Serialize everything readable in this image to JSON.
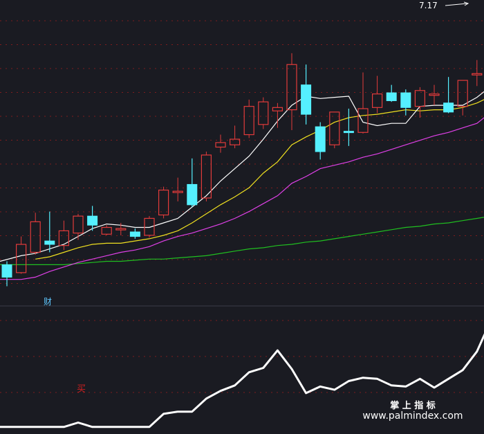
{
  "chart_data": [
    {
      "type": "candlestick",
      "panel": "price",
      "ylim": [
        4.55,
        7.2
      ],
      "colors": {
        "up": "#e33b3b",
        "down": "#55f0ff",
        "ma5": "#ffffff",
        "ma10": "#f0e020",
        "ma20": "#e040e8",
        "ma60": "#20c020",
        "grid": "#8a1e1e"
      },
      "annotations": {
        "high_label": "7.17",
        "finance_marker": "财"
      },
      "candles": [
        {
          "x": 0,
          "open": 4.89,
          "close": 4.78,
          "high": 4.92,
          "low": 4.7
        },
        {
          "x": 1,
          "open": 4.82,
          "close": 5.07,
          "high": 5.14,
          "low": 4.81
        },
        {
          "x": 2,
          "open": 5.0,
          "close": 5.27,
          "high": 5.35,
          "low": 4.98
        },
        {
          "x": 3,
          "open": 5.1,
          "close": 5.07,
          "high": 5.36,
          "low": 5.0
        },
        {
          "x": 4,
          "open": 5.06,
          "close": 5.19,
          "high": 5.28,
          "low": 5.02
        },
        {
          "x": 5,
          "open": 5.17,
          "close": 5.32,
          "high": 5.34,
          "low": 5.11
        },
        {
          "x": 6,
          "open": 5.32,
          "close": 5.24,
          "high": 5.41,
          "low": 5.19
        },
        {
          "x": 7,
          "open": 5.16,
          "close": 5.22,
          "high": 5.24,
          "low": 5.15
        },
        {
          "x": 8,
          "open": 5.2,
          "close": 5.21,
          "high": 5.26,
          "low": 5.15
        },
        {
          "x": 9,
          "open": 5.18,
          "close": 5.14,
          "high": 5.21,
          "low": 5.12
        },
        {
          "x": 10,
          "open": 5.15,
          "close": 5.3,
          "high": 5.32,
          "low": 5.13
        },
        {
          "x": 11,
          "open": 5.33,
          "close": 5.55,
          "high": 5.58,
          "low": 5.3
        },
        {
          "x": 12,
          "open": 5.53,
          "close": 5.54,
          "high": 5.66,
          "low": 5.45
        },
        {
          "x": 13,
          "open": 5.6,
          "close": 5.42,
          "high": 5.83,
          "low": 5.4
        },
        {
          "x": 14,
          "open": 5.48,
          "close": 5.86,
          "high": 5.89,
          "low": 5.45
        },
        {
          "x": 15,
          "open": 5.93,
          "close": 5.97,
          "high": 6.04,
          "low": 5.88
        },
        {
          "x": 16,
          "open": 5.95,
          "close": 6.0,
          "high": 6.12,
          "low": 5.92
        },
        {
          "x": 17,
          "open": 6.04,
          "close": 6.29,
          "high": 6.35,
          "low": 6.01
        },
        {
          "x": 18,
          "open": 6.13,
          "close": 6.33,
          "high": 6.37,
          "low": 6.09
        },
        {
          "x": 19,
          "open": 6.25,
          "close": 6.28,
          "high": 6.32,
          "low": 6.1
        },
        {
          "x": 20,
          "open": 6.26,
          "close": 6.66,
          "high": 6.76,
          "low": 6.08
        },
        {
          "x": 21,
          "open": 6.48,
          "close": 6.22,
          "high": 6.66,
          "low": 6.13
        },
        {
          "x": 22,
          "open": 6.11,
          "close": 5.89,
          "high": 6.15,
          "low": 5.82
        },
        {
          "x": 23,
          "open": 5.95,
          "close": 6.24,
          "high": 6.24,
          "low": 5.92
        },
        {
          "x": 24,
          "open": 6.07,
          "close": 6.06,
          "high": 6.27,
          "low": 5.94
        },
        {
          "x": 25,
          "open": 6.06,
          "close": 6.27,
          "high": 6.59,
          "low": 6.05
        },
        {
          "x": 26,
          "open": 6.28,
          "close": 6.4,
          "high": 6.56,
          "low": 6.23
        },
        {
          "x": 27,
          "open": 6.41,
          "close": 6.34,
          "high": 6.48,
          "low": 6.33
        },
        {
          "x": 28,
          "open": 6.41,
          "close": 6.28,
          "high": 6.44,
          "low": 6.21
        },
        {
          "x": 29,
          "open": 6.29,
          "close": 6.43,
          "high": 6.46,
          "low": 6.19
        },
        {
          "x": 30,
          "open": 6.4,
          "close": 6.4,
          "high": 6.48,
          "low": 6.3
        },
        {
          "x": 31,
          "open": 6.32,
          "close": 6.24,
          "high": 6.55,
          "low": 6.23
        },
        {
          "x": 32,
          "open": 6.29,
          "close": 6.52,
          "high": 6.52,
          "low": 6.21
        },
        {
          "x": 33,
          "open": 6.57,
          "close": 6.58,
          "high": 6.7,
          "low": 6.47
        },
        {
          "x": 34,
          "open": 6.58,
          "close": 7.03,
          "high": 7.17,
          "low": 6.55
        }
      ],
      "moving_averages": {
        "ma5": [
          4.92,
          4.97,
          4.99,
          5.03,
          5.07,
          5.14,
          5.21,
          5.25,
          5.24,
          5.22,
          5.22,
          5.26,
          5.3,
          5.4,
          5.5,
          5.63,
          5.74,
          5.85,
          6.0,
          6.16,
          6.3,
          6.38,
          6.36,
          6.37,
          6.38,
          6.15,
          6.12,
          6.14,
          6.14,
          6.29,
          6.3,
          6.3,
          6.3,
          6.37,
          6.47
        ],
        "ma10": [
          null,
          null,
          4.94,
          4.96,
          5.0,
          5.04,
          5.07,
          5.08,
          5.08,
          5.1,
          5.12,
          5.15,
          5.19,
          5.26,
          5.34,
          5.42,
          5.49,
          5.57,
          5.7,
          5.8,
          5.95,
          6.02,
          6.08,
          6.15,
          6.19,
          6.21,
          6.22,
          6.24,
          6.26,
          6.25,
          6.26,
          6.26,
          6.28,
          6.32,
          6.38
        ],
        "ma20": [
          4.76,
          4.76,
          4.78,
          4.83,
          4.87,
          4.91,
          4.94,
          4.97,
          5.0,
          5.02,
          5.05,
          5.1,
          5.14,
          5.17,
          5.21,
          5.25,
          5.3,
          5.36,
          5.43,
          5.5,
          5.61,
          5.67,
          5.74,
          5.77,
          5.8,
          5.84,
          5.87,
          5.91,
          5.95,
          5.99,
          6.03,
          6.06,
          6.1,
          6.14,
          6.24
        ],
        "ma60": [
          4.89,
          4.89,
          4.89,
          4.89,
          4.89,
          4.9,
          4.91,
          4.92,
          4.92,
          4.93,
          4.94,
          4.94,
          4.95,
          4.96,
          4.97,
          4.99,
          5.01,
          5.03,
          5.04,
          5.06,
          5.07,
          5.09,
          5.1,
          5.12,
          5.14,
          5.16,
          5.18,
          5.2,
          5.22,
          5.23,
          5.25,
          5.26,
          5.28,
          5.3,
          5.32
        ]
      }
    },
    {
      "type": "line",
      "panel": "indicator",
      "ylim": [
        0,
        100
      ],
      "colors": {
        "line": "#ffffff",
        "grid": "#8a1e1e",
        "buy_marker": "#d02020"
      },
      "annotations": {
        "buy_marker": "买"
      },
      "x": [
        0,
        1,
        2,
        3,
        4,
        5,
        6,
        7,
        8,
        9,
        10,
        11,
        12,
        13,
        14,
        15,
        16,
        17,
        18,
        19,
        20,
        21,
        22,
        23,
        24,
        25,
        26,
        27,
        28,
        29,
        30,
        31,
        32,
        33,
        34
      ],
      "values": [
        2,
        2,
        2,
        2,
        2,
        6,
        2,
        2,
        2,
        2,
        2,
        14,
        16,
        16,
        28,
        35,
        40,
        52,
        56,
        72,
        55,
        33,
        39,
        36,
        44,
        47,
        46,
        40,
        39,
        46,
        38,
        46,
        54,
        71,
        100
      ]
    }
  ],
  "watermark": {
    "title": "掌 上 指 标",
    "url": "www.palmindex.com"
  }
}
